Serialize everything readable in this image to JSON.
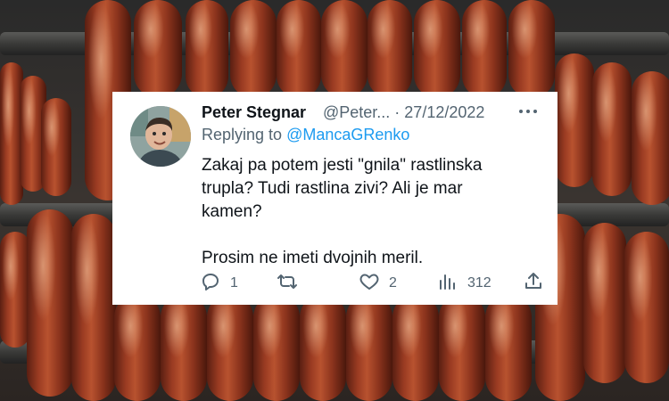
{
  "background": {
    "description_icon": "sausages-photo"
  },
  "tweet": {
    "author_name": "Peter Stegnar",
    "handle_date": "@Peter... · 27/12/2022",
    "more_icon": "more-dots-icon",
    "replying_to_label": "Replying to ",
    "replying_to_handle": "@MancaGRenko",
    "text": "Zakaj pa potem jesti \"gnila\" rastlinska\ntrupla? Tudi rastlina zivi? Ali je mar\nkamen?\n\nProsim ne imeti dvojnih meril.",
    "actions": {
      "reply_count": "1",
      "retweet_count": "",
      "like_count": "2",
      "views_count": "312"
    }
  },
  "colors": {
    "text": "#0f1419",
    "secondary": "#536471",
    "link": "#1d9bf0"
  }
}
